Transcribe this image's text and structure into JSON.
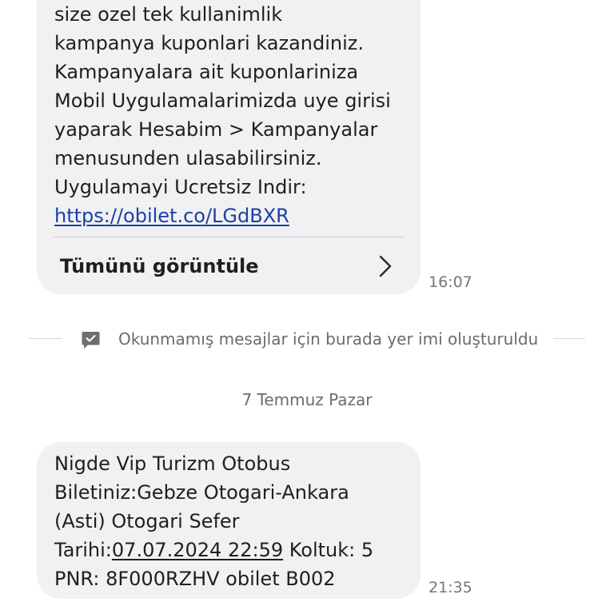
{
  "message1": {
    "lines": [
      "size ozel tek kullanimlik",
      "kampanya kuponlari kazandiniz.",
      "Kampanyalara ait kuponlariniza",
      "Mobil Uygulamalarimizda uye girisi",
      "yaparak Hesabim > Kampanyalar",
      "menusunden ulasabilirsiniz.",
      "Uygulamayi Ucretsiz Indir:"
    ],
    "link": "https://obilet.co/LGdBXR",
    "view_all_label": "Tümünü görüntüle",
    "time": "16:07"
  },
  "bookmark_notice": {
    "icon": "message-bookmark-icon",
    "text": "Okunmamış mesajlar için burada yer imi oluşturuldu"
  },
  "date_header": "7 Temmuz Pazar",
  "message2": {
    "lines": [
      "Nigde Vip Turizm Otobus",
      "Biletiniz:Gebze Otogari-Ankara",
      "(Asti) Otogari Sefer"
    ],
    "line4_prefix": "Tarihi:",
    "line4_date": "07.07.2024 22:59",
    "line4_suffix": " Koltuk: 5",
    "line5": "PNR: 8F000RZHV obilet B002",
    "time": "21:35"
  },
  "colors": {
    "bubble": "#f1f1f3",
    "link": "#1a3fa8",
    "meta_text": "#767676"
  }
}
